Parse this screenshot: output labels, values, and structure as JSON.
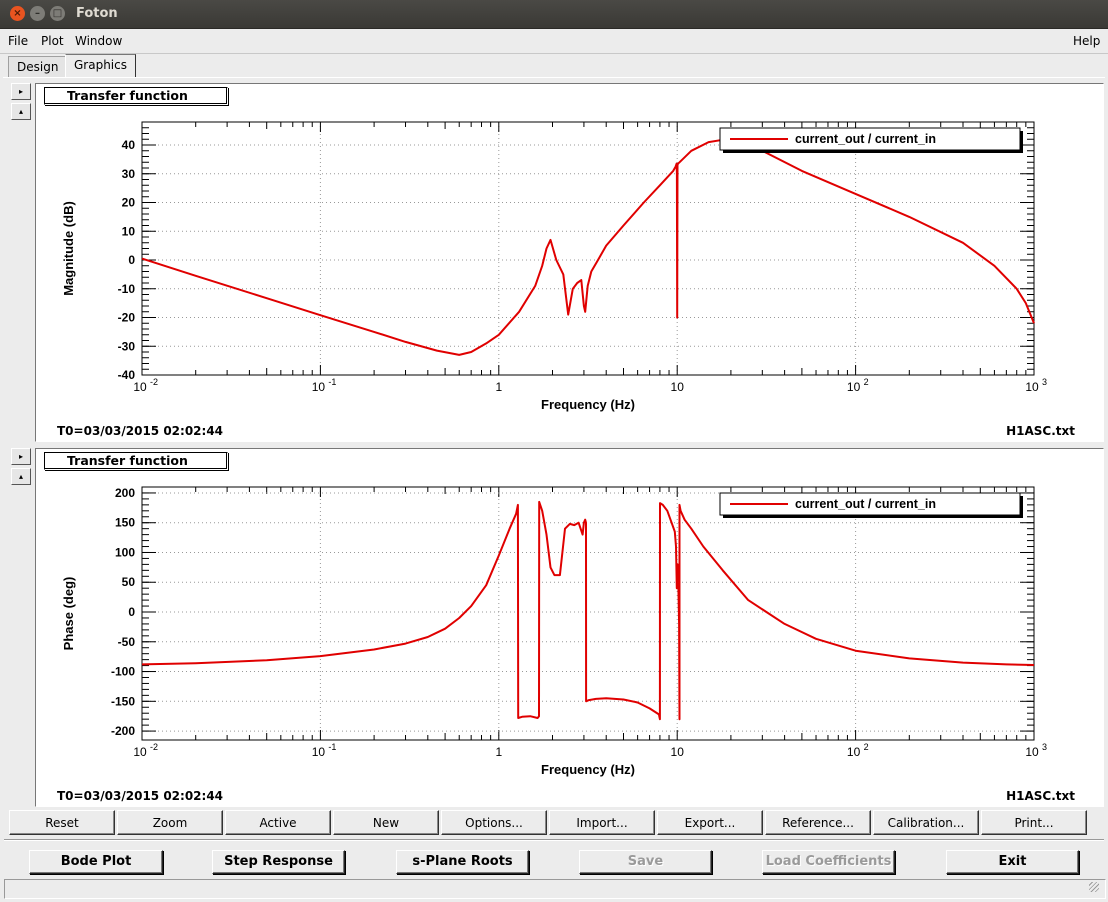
{
  "window": {
    "title": "Foton"
  },
  "menubar": {
    "file": "File",
    "plot": "Plot",
    "window": "Window",
    "help": "Help"
  },
  "tabs": {
    "design": "Design",
    "graphics": "Graphics"
  },
  "sidebuttons": {
    "expand": "▸",
    "collapse": "▴"
  },
  "panels": [
    {
      "title": "Transfer function",
      "t0": "T0=03/03/2015 02:02:44",
      "filename": "H1ASC.txt"
    },
    {
      "title": "Transfer function",
      "t0": "T0=03/03/2015 02:02:44",
      "filename": "H1ASC.txt"
    }
  ],
  "toolbar": [
    "Reset",
    "Zoom",
    "Active",
    "New",
    "Options...",
    "Import...",
    "Export...",
    "Reference...",
    "Calibration...",
    "Print..."
  ],
  "bottom_buttons": {
    "bode_plot": "Bode Plot",
    "step_response": "Step Response",
    "s_plane_roots": "s-Plane Roots",
    "save": "Save",
    "load_coefficients": "Load Coefficients",
    "exit": "Exit"
  },
  "chart_data": [
    {
      "type": "line",
      "xlabel": "Frequency (Hz)",
      "ylabel": "Magnitude (dB)",
      "xscale": "log",
      "xlim": [
        0.01,
        1000
      ],
      "ylim": [
        -40,
        48
      ],
      "x_ticks": [
        0.01,
        0.1,
        1,
        10,
        100,
        1000
      ],
      "x_tick_labels": [
        "10",
        "10",
        "1",
        "10",
        "10",
        "10"
      ],
      "x_tick_exponents": [
        "-2",
        "-1",
        "",
        "",
        "2",
        "3"
      ],
      "y_ticks": [
        -40,
        -30,
        -20,
        -10,
        0,
        10,
        20,
        30,
        40
      ],
      "grid": true,
      "legend": "top-right",
      "series": [
        {
          "name": "current_out / current_in",
          "color": "#e00000",
          "x": [
            0.01,
            0.02,
            0.05,
            0.1,
            0.2,
            0.3,
            0.45,
            0.6,
            0.7,
            0.85,
            1.0,
            1.3,
            1.6,
            1.75,
            1.85,
            1.95,
            2.1,
            2.3,
            2.45,
            2.6,
            2.75,
            2.9,
            3.0,
            3.05,
            3.15,
            3.3,
            3.6,
            4.0,
            5.0,
            6.5,
            8.0,
            9.5,
            9.8,
            9.92,
            9.96,
            10.0,
            10.04,
            10.1,
            10.3,
            12.0,
            15.0,
            18.0,
            22.0,
            30.0,
            50.0,
            100.0,
            200.0,
            400.0,
            600.0,
            800.0,
            900.0,
            1000.0
          ],
          "y": [
            0.5,
            -5.5,
            -13.3,
            -19.2,
            -25.0,
            -28.5,
            -31.5,
            -33.0,
            -32.0,
            -29.0,
            -26.0,
            -18.0,
            -9.0,
            -2.0,
            4.0,
            7.0,
            0.0,
            -5.0,
            -19.0,
            -10.0,
            -8.0,
            -7.0,
            -16.0,
            -18.0,
            -9.0,
            -4.0,
            0.0,
            5.0,
            12.0,
            20.0,
            26.0,
            31.0,
            32.5,
            33.5,
            30.0,
            -20.0,
            33.0,
            33.5,
            34.0,
            38.0,
            41.0,
            41.8,
            41.5,
            38.0,
            31.0,
            23.0,
            15.0,
            6.0,
            -2.0,
            -10.0,
            -15.0,
            -22.0
          ]
        }
      ]
    },
    {
      "type": "line",
      "xlabel": "Frequency (Hz)",
      "ylabel": "Phase (deg)",
      "xscale": "log",
      "xlim": [
        0.01,
        1000
      ],
      "ylim": [
        -215,
        210
      ],
      "x_ticks": [
        0.01,
        0.1,
        1,
        10,
        100,
        1000
      ],
      "x_tick_labels": [
        "10",
        "10",
        "1",
        "10",
        "10",
        "10"
      ],
      "x_tick_exponents": [
        "-2",
        "-1",
        "",
        "",
        "2",
        "3"
      ],
      "y_ticks": [
        -200,
        -150,
        -100,
        -50,
        0,
        50,
        100,
        150,
        200
      ],
      "grid": true,
      "legend": "top-right",
      "series": [
        {
          "name": "current_out / current_in",
          "color": "#e00000",
          "x": [
            0.01,
            0.02,
            0.05,
            0.1,
            0.2,
            0.3,
            0.4,
            0.5,
            0.6,
            0.7,
            0.85,
            1.0,
            1.15,
            1.25,
            1.28,
            1.285,
            1.35,
            1.5,
            1.65,
            1.68,
            1.685,
            1.75,
            1.85,
            1.95,
            2.05,
            2.2,
            2.35,
            2.5,
            2.65,
            2.8,
            2.95,
            3.0,
            3.05,
            3.08,
            3.085,
            3.2,
            3.5,
            4.0,
            5.0,
            6.0,
            7.0,
            7.9,
            8.0,
            8.005,
            8.3,
            8.8,
            9.3,
            9.7,
            9.85,
            9.95,
            10.0,
            10.05,
            10.15,
            10.25,
            10.3,
            10.305,
            10.45,
            11.0,
            12.0,
            14.0,
            18.0,
            25.0,
            40.0,
            60.0,
            100.0,
            200.0,
            400.0,
            700.0,
            1000.0
          ],
          "y": [
            -88,
            -86,
            -81,
            -74,
            -63,
            -53,
            -42,
            -28,
            -10,
            10,
            45,
            95,
            140,
            165,
            180,
            -178,
            -176,
            -175,
            -178,
            -175,
            185,
            170,
            130,
            75,
            62,
            62,
            140,
            148,
            146,
            150,
            130,
            150,
            155,
            150,
            -150,
            -148,
            -146,
            -145,
            -147,
            -152,
            -162,
            -172,
            -180,
            183,
            180,
            170,
            150,
            135,
            110,
            40,
            60,
            80,
            40,
            -20,
            -180,
            180,
            170,
            155,
            140,
            110,
            70,
            20,
            -20,
            -45,
            -65,
            -78,
            -85,
            -88,
            -89
          ]
        }
      ]
    }
  ]
}
